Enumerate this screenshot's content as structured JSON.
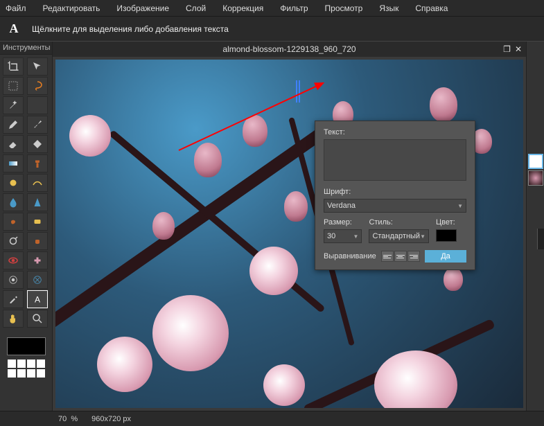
{
  "menubar": [
    "Файл",
    "Редактировать",
    "Изображение",
    "Слой",
    "Коррекция",
    "Фильтр",
    "Просмотр",
    "Язык",
    "Справка"
  ],
  "toolbar": {
    "active_tool_glyph": "A",
    "hint": "Щёлкните для выделения либо добавления текста"
  },
  "toolpanel": {
    "title": "Инструменты"
  },
  "document": {
    "title": "almond-blossom-1229138_960_720"
  },
  "dialog": {
    "text_label": "Текст:",
    "text_value": "",
    "font_label": "Шрифт:",
    "font_value": "Verdana",
    "size_label": "Размер:",
    "size_value": "30",
    "style_label": "Стиль:",
    "style_value": "Стандартный",
    "color_label": "Цвет:",
    "color_value": "#000000",
    "align_label": "Выравнивание",
    "ok_label": "Да"
  },
  "status": {
    "zoom": "70",
    "zoom_unit": "%",
    "dimensions": "960x720 px"
  }
}
